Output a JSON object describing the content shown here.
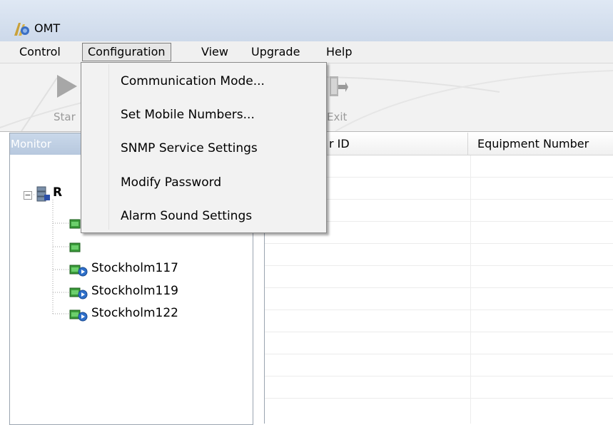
{
  "window": {
    "title": "OMT"
  },
  "menu": {
    "items": [
      "Control",
      "Configuration",
      "View",
      "Upgrade",
      "Help"
    ],
    "active": "Configuration"
  },
  "dropdown": {
    "items": [
      "Communication Mode...",
      "Set Mobile Numbers...",
      "SNMP Service Settings",
      "Modify Password",
      "Alarm Sound Settings"
    ]
  },
  "toolbar": {
    "start_label": "Star",
    "exit_label": "Exit"
  },
  "monitor_panel": {
    "header": "Monitor",
    "root_label": "R",
    "nodes": [
      "Stockholm117",
      "Stockholm119",
      "Stockholm122"
    ]
  },
  "grid": {
    "columns": [
      "r ID",
      "Equipment Number"
    ]
  },
  "colors": {
    "titlebar": "#dfe8f4",
    "menubar": "#f0f0f0",
    "panel_header": "#c9d8ea",
    "dropdown_bg": "#f2f2f2"
  },
  "icons": {
    "app": "omt-app-icon",
    "start": "play-icon",
    "exit": "exit-icon",
    "root": "server-group-icon",
    "node": "station-icon"
  }
}
